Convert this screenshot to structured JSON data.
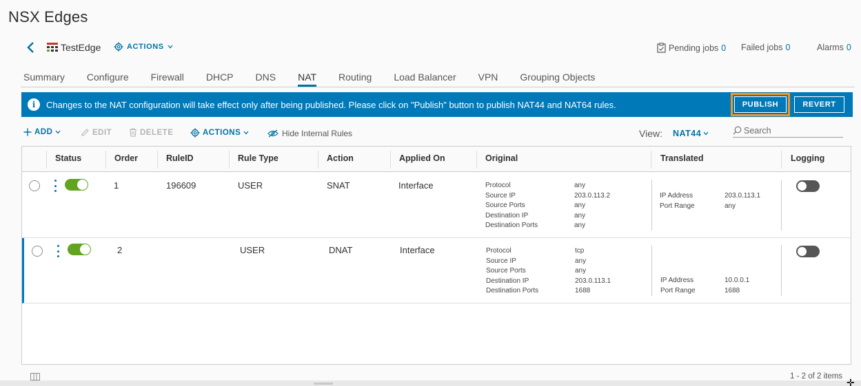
{
  "page": {
    "title": "NSX Edges"
  },
  "header": {
    "edge_name": "TestEdge",
    "actions_label": "ACTIONS",
    "pending_jobs_label": "Pending jobs",
    "pending_jobs_count": "0",
    "failed_jobs_label": "Failed jobs",
    "failed_jobs_count": "0",
    "alarms_label": "Alarms",
    "alarms_count": "0"
  },
  "tabs": [
    {
      "label": "Summary"
    },
    {
      "label": "Configure"
    },
    {
      "label": "Firewall"
    },
    {
      "label": "DHCP"
    },
    {
      "label": "DNS"
    },
    {
      "label": "NAT",
      "active": true
    },
    {
      "label": "Routing"
    },
    {
      "label": "Load Balancer"
    },
    {
      "label": "VPN"
    },
    {
      "label": "Grouping Objects"
    }
  ],
  "banner": {
    "message": "Changes to the NAT configuration will take effect only after being published. Please click on \"Publish\" button to publish NAT44 and NAT64 rules.",
    "publish_label": "PUBLISH",
    "revert_label": "REVERT"
  },
  "toolbar": {
    "add_label": "ADD",
    "edit_label": "EDIT",
    "delete_label": "DELETE",
    "actions_label": "ACTIONS",
    "hide_internal_label": "Hide Internal Rules",
    "view_label": "View:",
    "view_value": "NAT44",
    "search_placeholder": "Search"
  },
  "table": {
    "columns": [
      "Status",
      "Order",
      "RuleID",
      "Rule Type",
      "Action",
      "Applied On",
      "Original",
      "Translated",
      "Logging"
    ],
    "rows": [
      {
        "order": "1",
        "rule_id": "196609",
        "rule_type": "USER",
        "action": "SNAT",
        "applied_on": "Interface",
        "status_enabled": true,
        "logging_enabled": false,
        "original_keys": [
          "Protocol",
          "Source IP",
          "Source Ports",
          "Destination IP",
          "Destination Ports"
        ],
        "original_values": [
          "any",
          "203.0.113.2",
          "any",
          "any",
          "any"
        ],
        "translated_keys": [
          "IP Address",
          "Port Range"
        ],
        "translated_values": [
          "203.0.113.1",
          "any"
        ]
      },
      {
        "order": "2",
        "rule_id": "",
        "rule_type": "USER",
        "action": "DNAT",
        "applied_on": "Interface",
        "status_enabled": true,
        "logging_enabled": false,
        "original_keys": [
          "Protocol",
          "Source IP",
          "Source Ports",
          "Destination IP",
          "Destination Ports"
        ],
        "original_values": [
          "tcp",
          "any",
          "any",
          "203.0.113.1",
          "1688"
        ],
        "translated_keys": [
          "IP Address",
          "Port Range"
        ],
        "translated_values": [
          "10.0.0.1",
          "1688"
        ]
      }
    ],
    "footer_count": "1 - 2 of 2 items"
  },
  "colors": {
    "accent": "#0072a3",
    "banner": "#0079b8",
    "highlight": "#f7931e",
    "toggle_on": "#62a420",
    "toggle_off": "#565656"
  },
  "icons": [
    "back-icon",
    "edge-icon",
    "gear-icon",
    "clipboard-icon",
    "info-icon",
    "plus-icon",
    "pencil-icon",
    "trash-icon",
    "eye-slash-icon",
    "chevron-down-icon",
    "search-icon",
    "column-toggle-icon"
  ]
}
